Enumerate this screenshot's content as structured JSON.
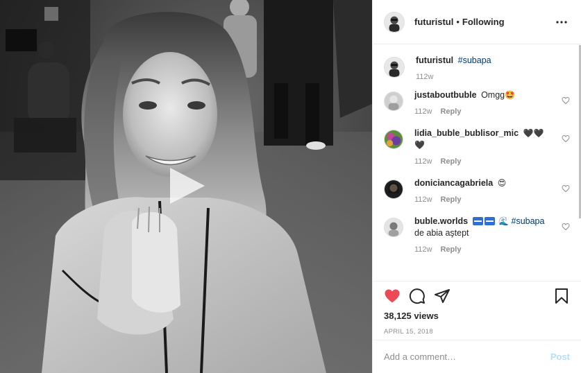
{
  "post": {
    "author": "futuristul",
    "follow_status": "Following",
    "separator": "•"
  },
  "caption": {
    "user": "futuristul",
    "hashtag": "#subapa",
    "time": "112w"
  },
  "comments": [
    {
      "user": "justaboutbuble",
      "text": "Omgg",
      "emoji": "🤩",
      "time": "112w",
      "reply": "Reply",
      "avatar_color": "#b8b8b8"
    },
    {
      "user": "lidia_buble_bublisor_mic",
      "text": "",
      "emoji": "🖤🖤🖤",
      "time": "112w",
      "reply": "Reply",
      "avatar_color": "#7a4ea0"
    },
    {
      "user": "doniciancagabriela",
      "text": "",
      "emoji": "😍",
      "time": "112w",
      "reply": "Reply",
      "avatar_color": "#2b2b2b"
    },
    {
      "user": "buble.worlds",
      "emoji": "🌊",
      "hashtag": "#subapa",
      "text_line2": "de abia aştept",
      "time": "112w",
      "reply": "Reply",
      "avatar_color": "#d9d9d9"
    }
  ],
  "stats": {
    "views_count": "38,125",
    "views_label": "views",
    "date": "APRIL 15, 2018"
  },
  "add_comment": {
    "placeholder": "Add a comment…",
    "post_label": "Post"
  },
  "icons": {
    "like": "heart-filled-icon",
    "comment": "comment-bubble-icon",
    "share": "paper-plane-icon",
    "save": "bookmark-icon",
    "more": "more-dots-icon",
    "play": "play-icon"
  },
  "colors": {
    "like_red": "#ed4956",
    "link_blue": "#00376b",
    "post_disabled": "#b2dffc",
    "muted": "#8e8e8e"
  }
}
